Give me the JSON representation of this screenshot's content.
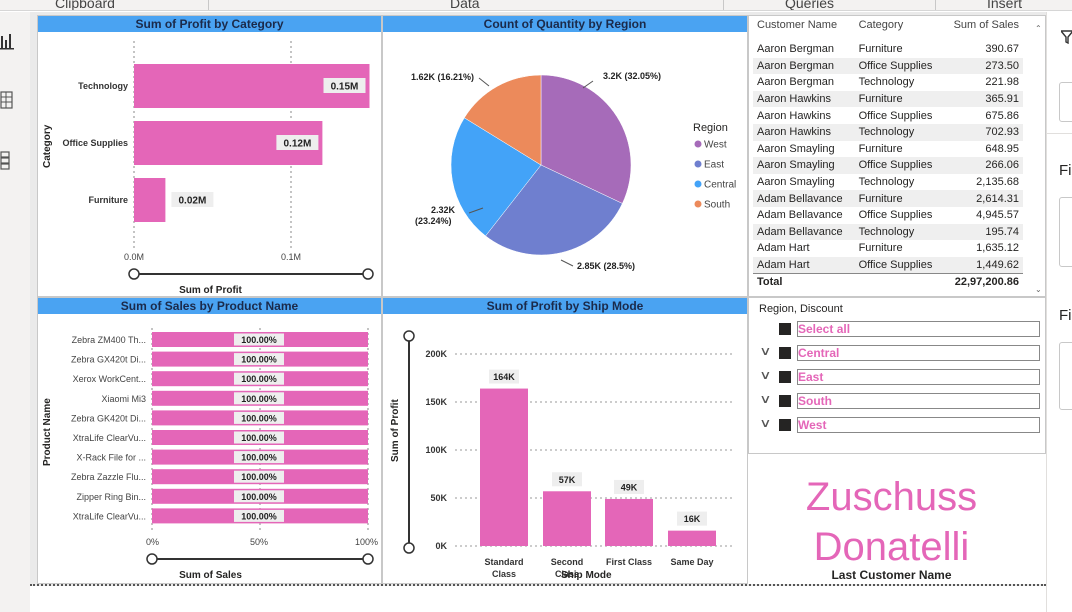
{
  "ribbon": {
    "groups": [
      "Clipboard",
      "Data",
      "Queries",
      "Insert"
    ]
  },
  "profit_by_category": {
    "title": "Sum of Profit by Category",
    "ylabel": "Category",
    "xlabel": "Sum of Profit",
    "ticks": [
      "0.0M",
      "0.1M"
    ],
    "chart_data": {
      "type": "bar",
      "categories": [
        "Technology",
        "Office Supplies",
        "Furniture"
      ],
      "values": [
        0.15,
        0.12,
        0.02
      ],
      "labels": [
        "0.15M",
        "0.12M",
        "0.02M"
      ],
      "xlim": [
        0,
        0.15
      ],
      "color": "#e466b8"
    }
  },
  "quantity_by_region": {
    "title": "Count of Quantity by Region",
    "legend_title": "Region",
    "chart_data": {
      "type": "pie",
      "categories": [
        "West",
        "East",
        "Central",
        "South"
      ],
      "values": [
        3200,
        2850,
        2320,
        1620
      ],
      "percent": [
        32.05,
        28.5,
        23.24,
        16.21
      ],
      "labels": [
        "3.2K (32.05%)",
        "2.85K (28.5%)",
        "2.32K (23.24%)",
        "1.62K (16.21%)"
      ],
      "colors": [
        "#a66bb9",
        "#6f7fcf",
        "#43a3f8",
        "#ec8a5b"
      ]
    }
  },
  "sales_table": {
    "headers": [
      "Customer Name",
      "Category",
      "Sum of Sales"
    ],
    "rows": [
      [
        "Aaron Bergman",
        "Furniture",
        "390.67"
      ],
      [
        "Aaron Bergman",
        "Office Supplies",
        "273.50"
      ],
      [
        "Aaron Bergman",
        "Technology",
        "221.98"
      ],
      [
        "Aaron Hawkins",
        "Furniture",
        "365.91"
      ],
      [
        "Aaron Hawkins",
        "Office Supplies",
        "675.86"
      ],
      [
        "Aaron Hawkins",
        "Technology",
        "702.93"
      ],
      [
        "Aaron Smayling",
        "Furniture",
        "648.95"
      ],
      [
        "Aaron Smayling",
        "Office Supplies",
        "266.06"
      ],
      [
        "Aaron Smayling",
        "Technology",
        "2,135.68"
      ],
      [
        "Adam Bellavance",
        "Furniture",
        "2,614.31"
      ],
      [
        "Adam Bellavance",
        "Office Supplies",
        "4,945.57"
      ],
      [
        "Adam Bellavance",
        "Technology",
        "195.74"
      ],
      [
        "Adam Hart",
        "Furniture",
        "1,635.12"
      ],
      [
        "Adam Hart",
        "Office Supplies",
        "1,449.62"
      ]
    ],
    "total_label": "Total",
    "total_value": "22,97,200.86"
  },
  "sales_by_product": {
    "title": "Sum of Sales by Product Name",
    "ylabel": "Product Name",
    "xlabel": "Sum of Sales",
    "ticks": [
      "0%",
      "50%",
      "100%"
    ],
    "chart_data": {
      "type": "bar",
      "categories": [
        "Zebra ZM400 Th...",
        "Zebra GX420t Di...",
        "Xerox WorkCent...",
        "Xiaomi Mi3",
        "Zebra GK420t Di...",
        "XtraLife ClearVu...",
        "X-Rack File for ...",
        "Zebra Zazzle Flu...",
        "Zipper Ring Bin...",
        "XtraLife ClearVu..."
      ],
      "values": [
        100,
        100,
        100,
        100,
        100,
        100,
        100,
        100,
        100,
        100
      ],
      "labels": [
        "100.00%",
        "100.00%",
        "100.00%",
        "100.00%",
        "100.00%",
        "100.00%",
        "100.00%",
        "100.00%",
        "100.00%",
        "100.00%"
      ],
      "xlim": [
        0,
        100
      ],
      "color": "#e466b8"
    }
  },
  "profit_by_shipmode": {
    "title": "Sum of Profit by Ship Mode",
    "ylabel": "Sum of Profit",
    "xlabel": "Ship Mode",
    "yticks": [
      "0K",
      "50K",
      "100K",
      "150K",
      "200K"
    ],
    "chart_data": {
      "type": "bar",
      "categories": [
        "Standard Class",
        "Second Class",
        "First Class",
        "Same Day"
      ],
      "values": [
        164,
        57,
        49,
        16
      ],
      "labels": [
        "164K",
        "57K",
        "49K",
        "16K"
      ],
      "ylim": [
        0,
        200
      ],
      "color": "#e466b8"
    }
  },
  "slicer": {
    "title": "Region, Discount",
    "items": [
      "Select all",
      "Central",
      "East",
      "South",
      "West"
    ]
  },
  "card": {
    "value_line1": "Zuschuss",
    "value_line2": "Donatelli",
    "label": "Last Customer Name"
  },
  "right_pane": {
    "letters": [
      "Fi",
      "Fi"
    ]
  }
}
